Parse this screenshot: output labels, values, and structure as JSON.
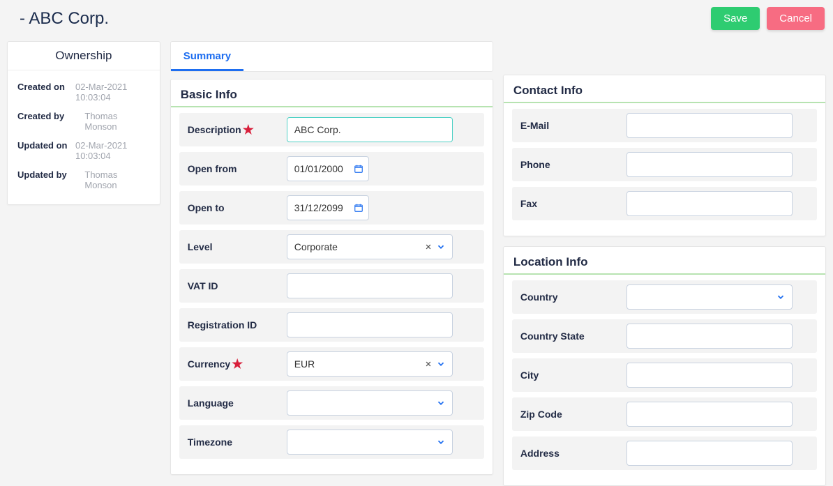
{
  "header": {
    "title": " - ABC Corp.",
    "save_label": "Save",
    "cancel_label": "Cancel"
  },
  "ownership": {
    "title": "Ownership",
    "rows": [
      {
        "label": "Created on",
        "value": "02-Mar-2021 10:03:04"
      },
      {
        "label": "Created by",
        "value": "Thomas Monson"
      },
      {
        "label": "Updated on",
        "value": "02-Mar-2021 10:03:04"
      },
      {
        "label": "Updated by",
        "value": "Thomas Monson"
      }
    ]
  },
  "tabs": {
    "summary_label": "Summary"
  },
  "basic_info": {
    "title": "Basic Info",
    "description_label": "Description",
    "description_value": "ABC Corp.",
    "open_from_label": "Open from",
    "open_from_value": "01/01/2000",
    "open_to_label": "Open to",
    "open_to_value": "31/12/2099",
    "level_label": "Level",
    "level_value": "Corporate",
    "vat_id_label": "VAT ID",
    "vat_id_value": "",
    "registration_id_label": "Registration ID",
    "registration_id_value": "",
    "currency_label": "Currency",
    "currency_value": "EUR",
    "language_label": "Language",
    "language_value": "",
    "timezone_label": "Timezone",
    "timezone_value": ""
  },
  "contact_info": {
    "title": "Contact Info",
    "email_label": "E-Mail",
    "email_value": "",
    "phone_label": "Phone",
    "phone_value": "",
    "fax_label": "Fax",
    "fax_value": ""
  },
  "location_info": {
    "title": "Location Info",
    "country_label": "Country",
    "country_value": "",
    "country_state_label": "Country State",
    "country_state_value": "",
    "city_label": "City",
    "city_value": "",
    "zip_code_label": "Zip Code",
    "zip_code_value": "",
    "address_label": "Address",
    "address_value": ""
  }
}
